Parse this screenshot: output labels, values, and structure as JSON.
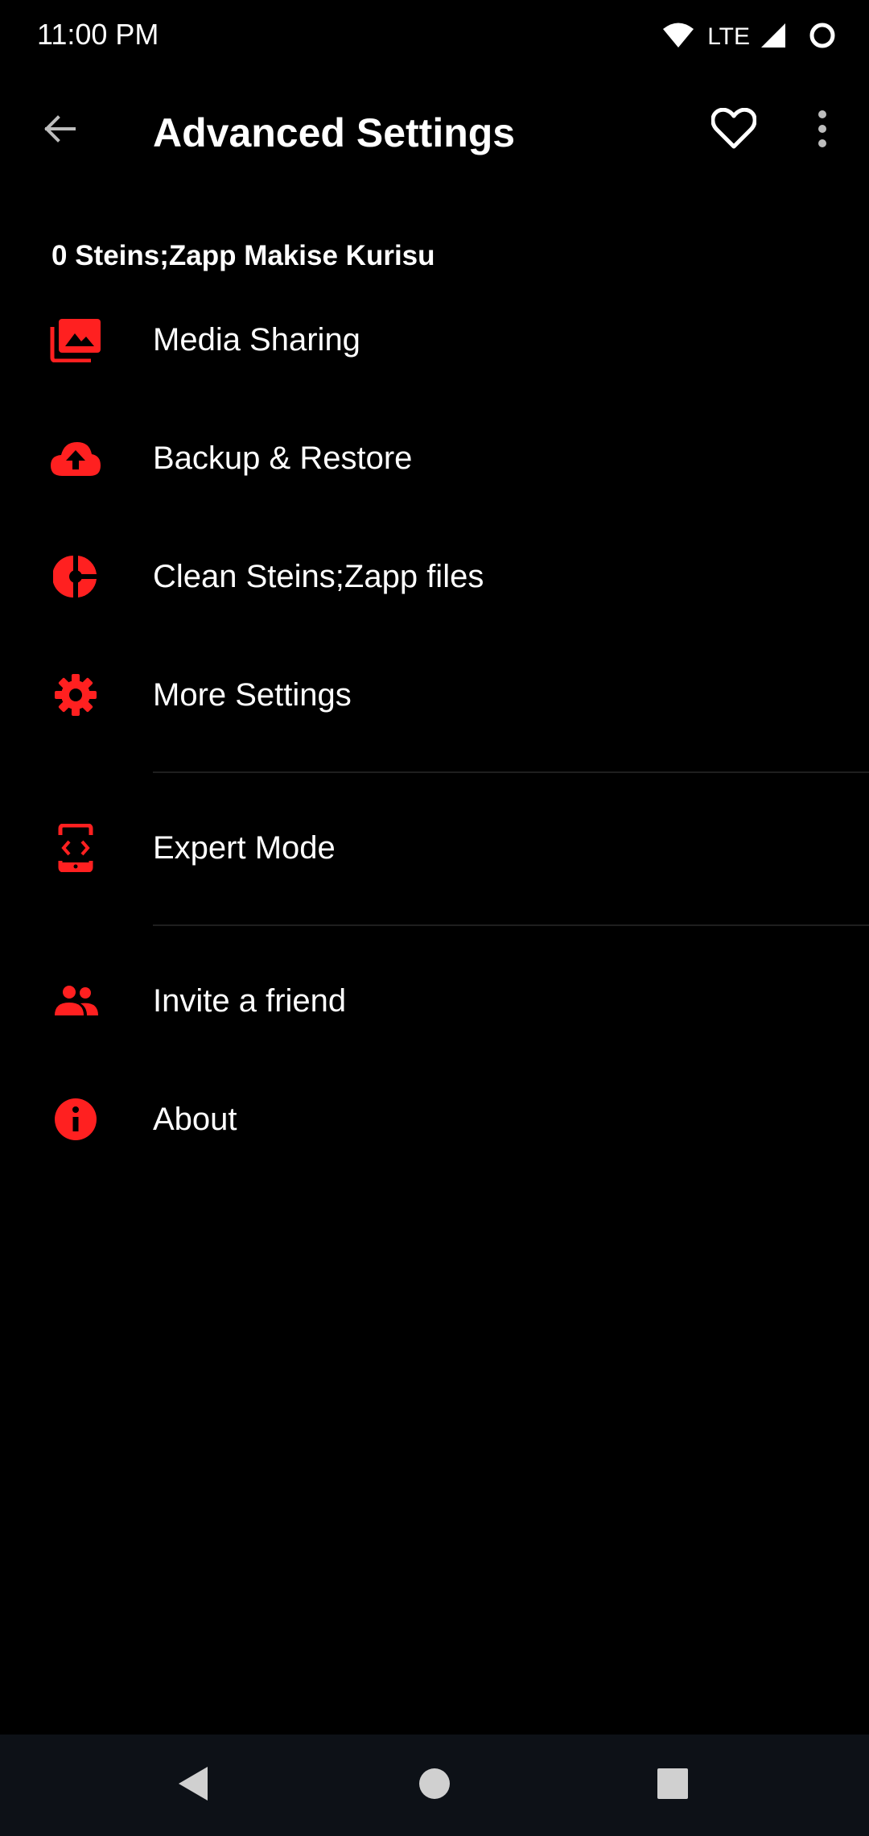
{
  "status_bar": {
    "time": "11:00 PM",
    "network": "LTE",
    "icons": [
      "wifi-icon",
      "signal-icon",
      "circle-status-icon"
    ]
  },
  "app_bar": {
    "title": "Advanced Settings",
    "back_icon": "arrow-back-icon",
    "favorite_icon": "heart-outline-icon",
    "more_icon": "more-vert-icon"
  },
  "account": {
    "label": "0 Steins;Zapp Makise Kurisu"
  },
  "menu": {
    "items": [
      {
        "label": "Media Sharing",
        "icon": "photo-library-icon"
      },
      {
        "label": "Backup & Restore",
        "icon": "cloud-upload-icon"
      },
      {
        "label": "Clean Steins;Zapp files",
        "icon": "storage-pie-icon"
      },
      {
        "label": "More Settings",
        "icon": "gear-icon"
      },
      {
        "label": "Expert Mode",
        "icon": "developer-mode-icon"
      },
      {
        "label": "Invite a friend",
        "icon": "people-icon"
      },
      {
        "label": "About",
        "icon": "info-icon"
      }
    ]
  },
  "nav_bar": {
    "back_icon": "nav-back-icon",
    "home_icon": "nav-home-icon",
    "recents_icon": "nav-recents-icon"
  },
  "colors": {
    "accent": "#ff2020",
    "background": "#000000",
    "nav_background": "#0d1117",
    "divider": "#1e1e1e"
  }
}
